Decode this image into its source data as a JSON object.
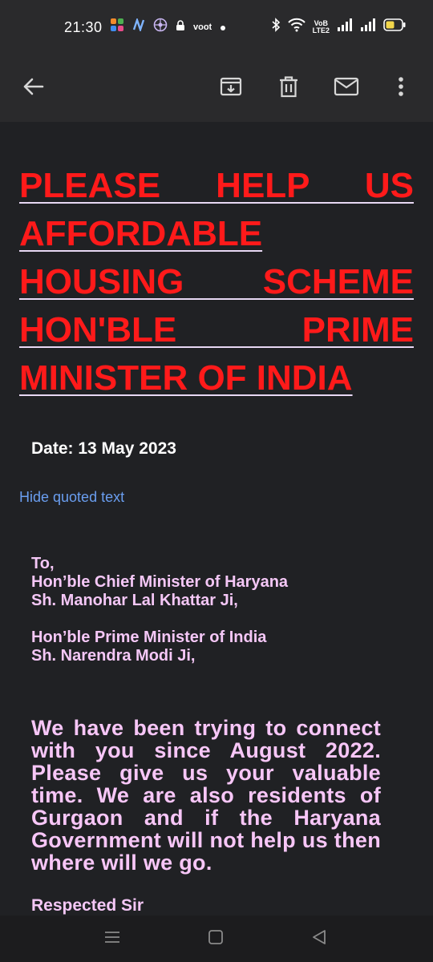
{
  "status_bar": {
    "time": "21:30",
    "left_icons": [
      "pinwheel-app-icon",
      "n-app-icon",
      "globe-app-icon",
      "lock-app-icon",
      "voot-app-icon",
      "dot-icon"
    ],
    "voot_label": "voot",
    "right_icons": [
      "bluetooth-icon",
      "wifi-icon",
      "volte-icon",
      "signal-icon",
      "signal-icon",
      "battery-icon"
    ],
    "volte_line1": "VoB",
    "volte_line2": "LTE2",
    "battery_color": "#f2d64b"
  },
  "toolbar": {
    "back_icon": "arrow-left-icon",
    "archive_icon": "archive-icon",
    "delete_icon": "trash-icon",
    "mark_unread_icon": "mail-icon",
    "more_icon": "more-vertical-icon"
  },
  "email": {
    "headline": "PLEASE HELP US AFFORDABLE HOUSING SCHEME HON'BLE PRIME MINISTER OF INDIA",
    "date_line": "Date: 13 May 2023",
    "hide_quoted": "Hide quoted text",
    "address": {
      "to": "To,",
      "line1": "Hon’ble Chief Minister of Haryana",
      "line2": "Sh. Manohar Lal Khattar Ji,",
      "line3": "Hon’ble Prime Minister of India",
      "line4": "Sh. Narendra Modi Ji,"
    },
    "body": "We have been trying to connect with you since August 2022. Please give us your valuable time. We are also residents of Gurgaon and if the Haryana Government will not help us then where will we go.",
    "salutation": "Respected Sir"
  },
  "nav_bar": {
    "recents_icon": "menu-lines-icon",
    "home_icon": "square-icon",
    "back_icon": "triangle-back-icon"
  },
  "colors": {
    "background": "#202124",
    "bars": "#2a2a2c",
    "headline": "#ff1a1a",
    "body_text": "#f7c6f7",
    "link": "#6a9ef0"
  }
}
